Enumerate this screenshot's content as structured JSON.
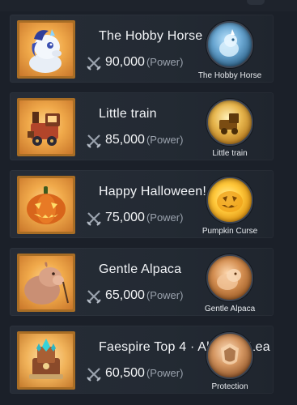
{
  "colors": {
    "background": "#1b2029",
    "row": "#262c36",
    "thumb_frame": "#a86d25",
    "text_primary": "#f2f4f7",
    "text_secondary": "#9aa2ad"
  },
  "items": [
    {
      "title": "The Hobby Horse",
      "power_value": "90,000",
      "power_unit": "(Power)",
      "medal_label": "The Hobby Horse",
      "thumb_icon": "blue-unicorn-pony-icon",
      "medal_icon": "hobby-horse-medal-icon"
    },
    {
      "title": "Little train",
      "power_value": "85,000",
      "power_unit": "(Power)",
      "medal_label": "Little train",
      "thumb_icon": "toy-train-icon",
      "medal_icon": "little-train-medal-icon"
    },
    {
      "title": "Happy Halloween!",
      "power_value": "75,000",
      "power_unit": "(Power)",
      "medal_label": "Pumpkin Curse",
      "thumb_icon": "jack-o-lantern-icon",
      "medal_icon": "pumpkin-curse-medal-icon"
    },
    {
      "title": "Gentle Alpaca",
      "power_value": "65,000",
      "power_unit": "(Power)",
      "medal_label": "Gentle Alpaca",
      "thumb_icon": "alpaca-icon",
      "medal_icon": "gentle-alpaca-medal-icon"
    },
    {
      "title": "Faespire Top 4 · Alliance Lea",
      "power_value": "60,500",
      "power_unit": "(Power)",
      "medal_label": "Protection",
      "thumb_icon": "crystal-throne-icon",
      "medal_icon": "protection-medal-icon"
    }
  ]
}
